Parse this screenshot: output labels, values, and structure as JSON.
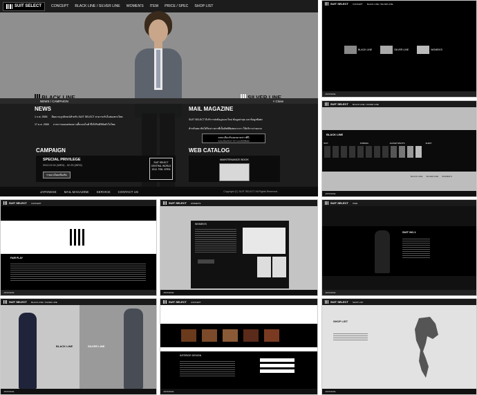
{
  "main": {
    "logo": "SUIT SELECT",
    "nav": [
      "CONCEPT",
      "BLACK LINE / SILVER LINE",
      "WOMEN'S",
      "ITEM",
      "PRICE / SPEC",
      "SHOP LIST"
    ],
    "hero_left": "BLACK LINE",
    "hero_right": "SILVER LINE",
    "news_bar": "NEWS / CAMPAIGN",
    "close": "× Close",
    "news_title": "NEWS",
    "news_items": [
      {
        "date": "1 ก.พ. 2555",
        "text": "มีผลงานรูปลักษณ์สำหรับ SUIT SELECT สามารถรับในช่องทางไทย"
      },
      {
        "date": "17 ม.ค. 2555",
        "text": "จากการเผยแพร่ผลงานสั้นรอบไลฟ์ ซึ่งได้รับดิจิทัลหัวใจไทย"
      }
    ],
    "mail_title": "MAIL MAGAZINE",
    "mail_text": "SUIT SELECT มีบริการส่งข้อมูลและไหม่ ข้อมูลล่าสุด และข้อมูลพิเศษ",
    "mail_text2": "สำหรับสมาชิกได้รับข่าวสารที่เป็นสิทธิพิเศษจากเรา ใช้บริการง่ายดาย",
    "mail_button": "ลงทะเบียนรับจดหมายข่าวที่นี่",
    "mail_button_sub": "ลงทะเบียนรับข่าวสารและสิทธิพิเศษ",
    "campaign_title": "CAMPAIGN",
    "campaign_name": "SPECIAL PRIVILEGE",
    "campaign_dates": "2012.02.01 (WED) - 02.29 (WED)",
    "campaign_button": "รายละเอียดเพิ่มเติม",
    "campaign_badge": [
      "SUIT SELECT",
      "CENTRAL WORLD",
      "2012. FEB. OPEN"
    ],
    "catalog_title": "WEB CATALOG",
    "catalog_book": "MAINTENANCE BOOK",
    "footer": [
      "JAPANESE",
      "MAIL MAGAZINE",
      "SERVICE",
      "CONTACT US"
    ],
    "copyright": "Copyright (C) SUIT SELECT All Rights Reserved."
  },
  "thumbs": {
    "t1": {
      "labels": [
        "BLACK LINE",
        "SILVER LINE",
        "WOMEN'S"
      ]
    },
    "t2": {
      "title": "BLACK LINE",
      "sections": [
        "SUIT",
        "FORMAL",
        "JACKET/PANTS",
        "SHIRT"
      ],
      "tags": [
        "BLACK LINE",
        "SILVER LINE",
        "WOMEN'S"
      ]
    },
    "t3": {
      "label": "FAIR PLAY"
    },
    "t4": {
      "label": "WOMEN'S"
    },
    "t5": {
      "label": "SUIT NO.1"
    },
    "t6": {
      "left": "BLACK LINE",
      "right": "SILVER LINE"
    },
    "t7": {
      "label": "INTERIOR DESIGN"
    },
    "t8": {
      "label": "SHOP LIST"
    },
    "mini_nav": [
      "CONCEPT",
      "BLACK LINE / SILVER LINE",
      "WOMEN'S",
      "ITEM",
      "PRICE / SPEC",
      "SHOP LIST"
    ],
    "mini_foot": [
      "JAPANESE",
      "MAIL MAGAZINE",
      "SERVICE",
      "CONTACT US"
    ]
  },
  "colors": {
    "nav": "#1a1a1a",
    "hero": "#8f8f8f",
    "panel": "#1e1e1e",
    "black": "#000000",
    "grey": "#c4c4c4"
  }
}
